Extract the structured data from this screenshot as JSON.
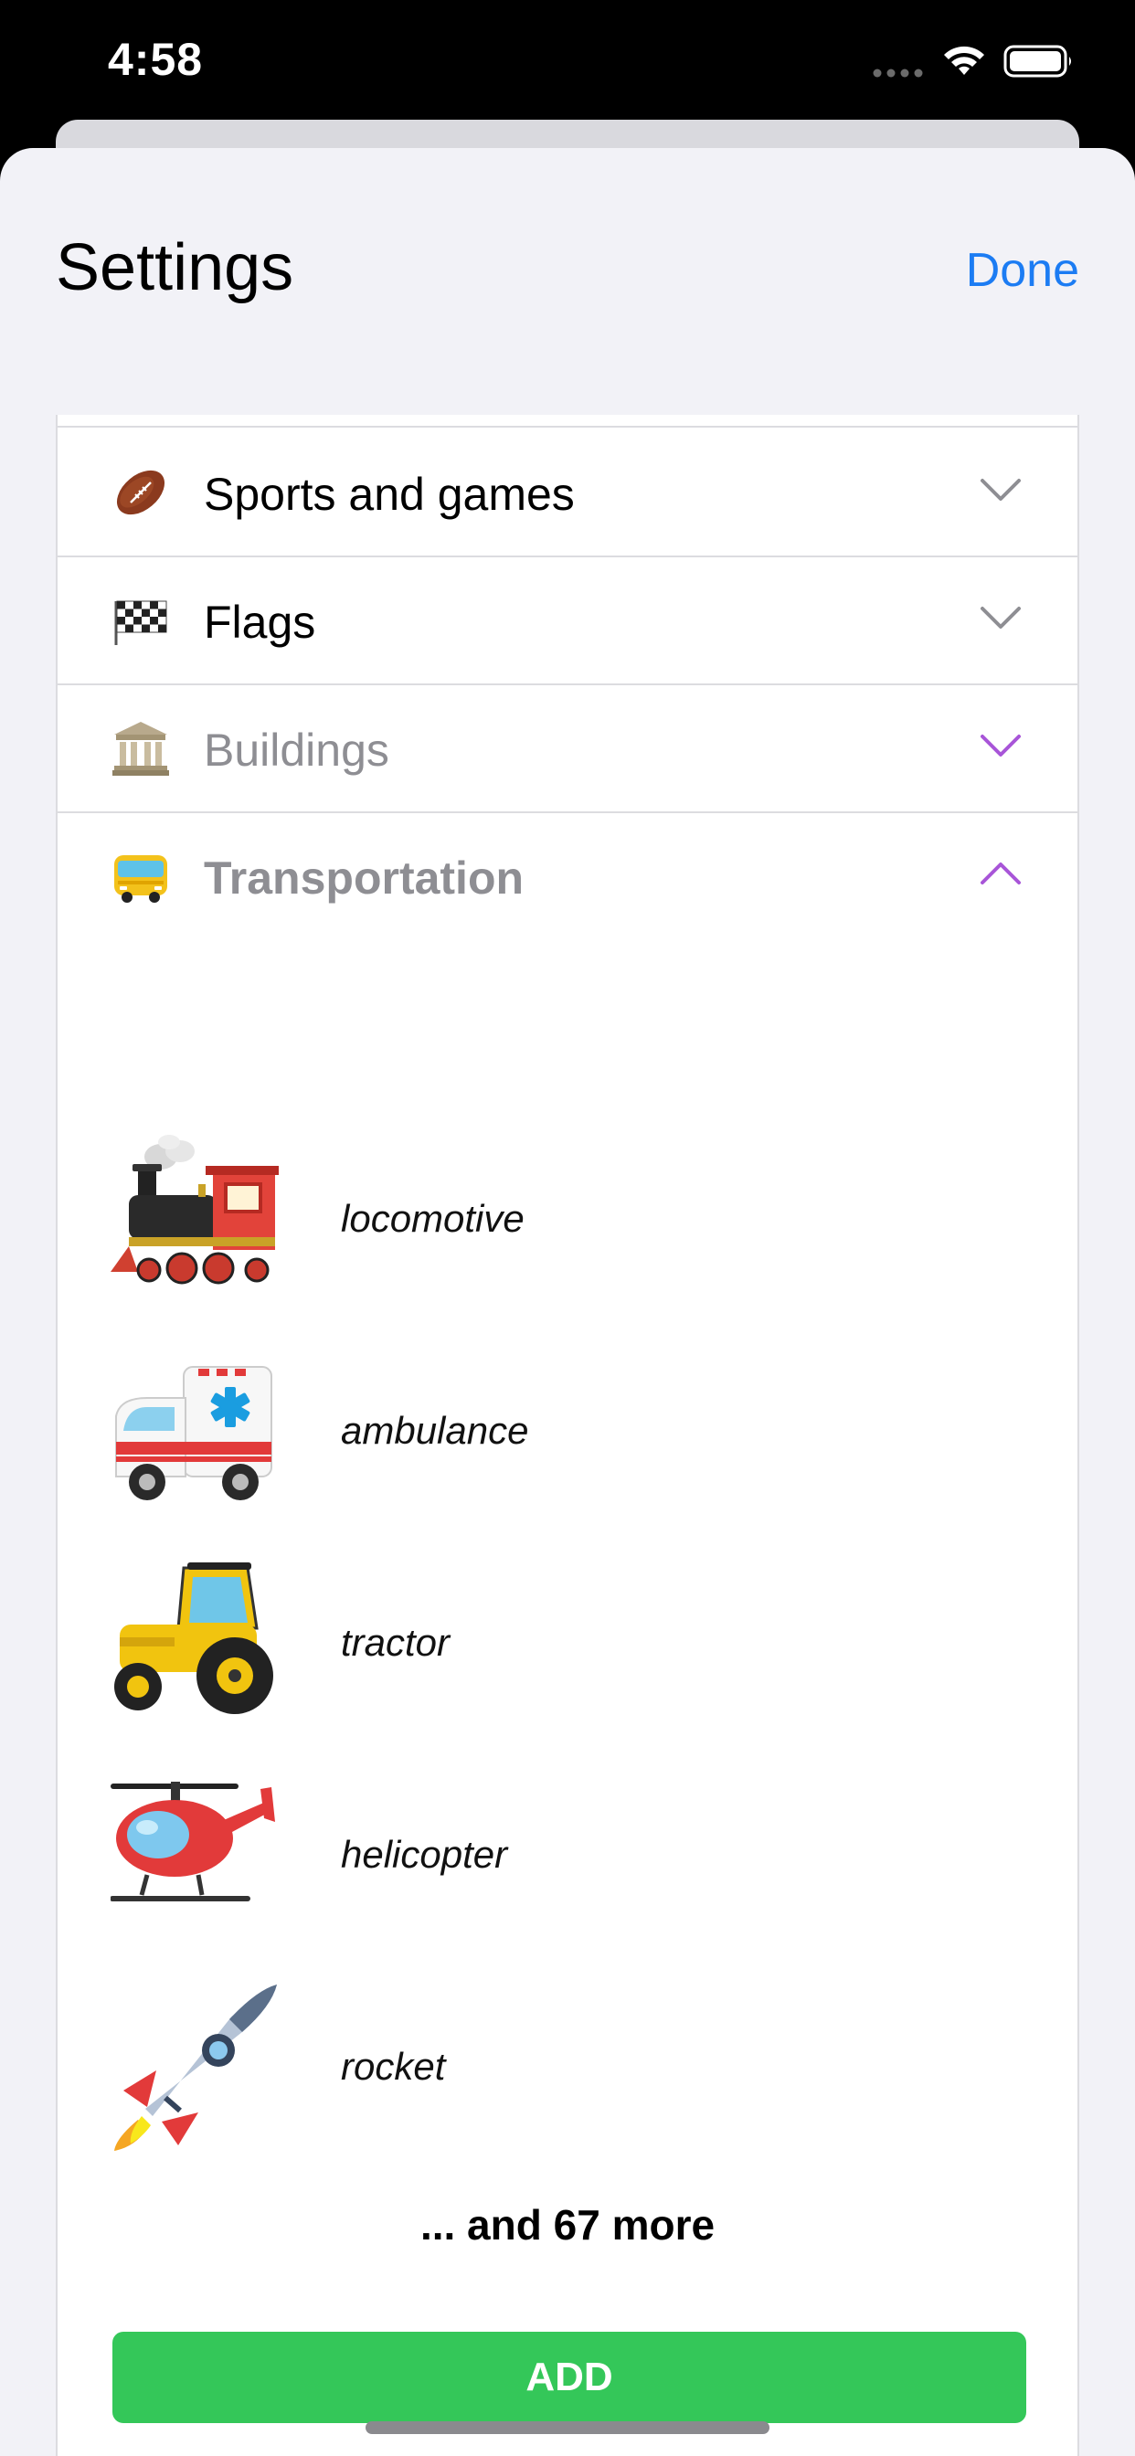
{
  "status_bar": {
    "time": "4:58"
  },
  "header": {
    "title": "Settings",
    "done_label": "Done"
  },
  "categories": [
    {
      "label": "Sports and games",
      "icon": "football-icon",
      "state": "collapsed"
    },
    {
      "label": "Flags",
      "icon": "checkered-flag-icon",
      "state": "collapsed"
    },
    {
      "label": "Buildings",
      "icon": "classical-building-icon",
      "state": "collapsed"
    },
    {
      "label": "Transportation",
      "icon": "bus-icon",
      "state": "expanded"
    }
  ],
  "items": [
    {
      "label": "locomotive",
      "icon": "locomotive-icon"
    },
    {
      "label": "ambulance",
      "icon": "ambulance-icon"
    },
    {
      "label": "tractor",
      "icon": "tractor-icon"
    },
    {
      "label": "helicopter",
      "icon": "helicopter-icon"
    },
    {
      "label": "rocket",
      "icon": "rocket-icon"
    }
  ],
  "more_text": "... and 67 more",
  "add_label": "ADD",
  "colors": {
    "accent_blue": "#1c7cf3",
    "chevron_purple": "#a855d8",
    "add_green": "#34c759",
    "background": "#f2f2f7"
  }
}
